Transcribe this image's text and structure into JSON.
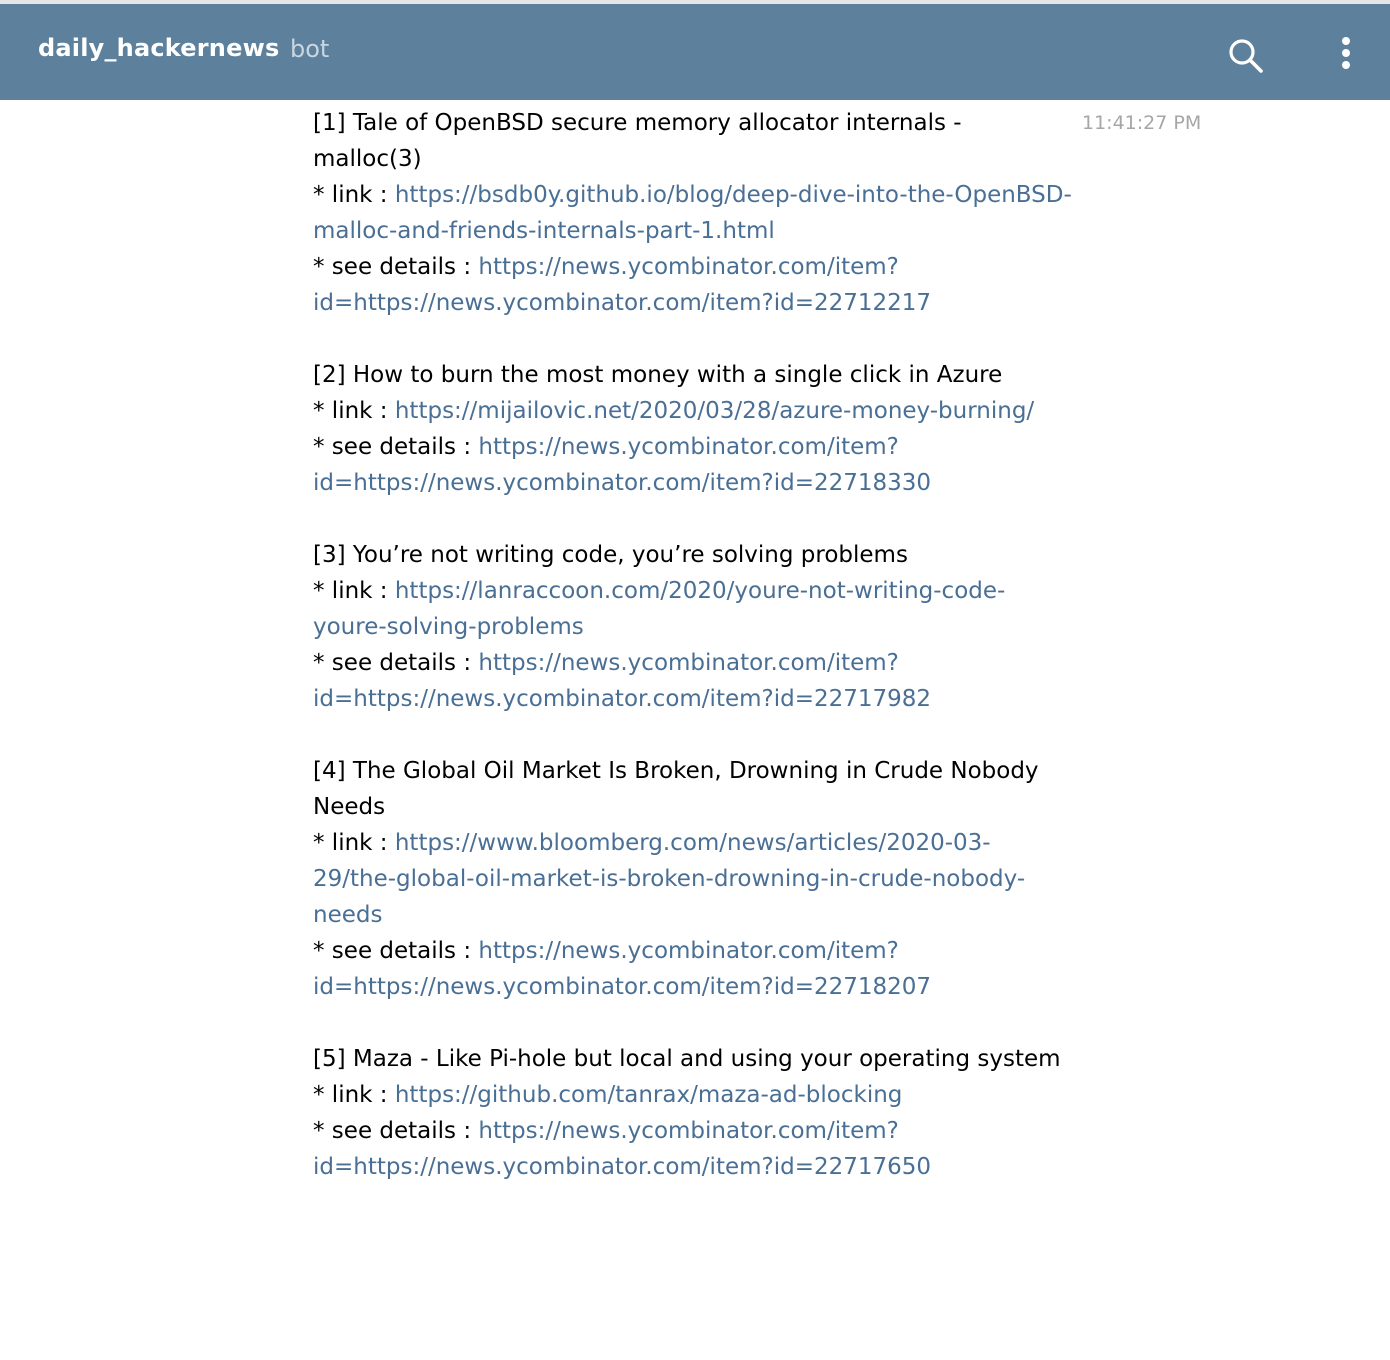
{
  "header": {
    "title": "daily_hackernews",
    "subtitle": "bot"
  },
  "message": {
    "timestamp": "11:41:27 PM",
    "link_label": "* link : ",
    "details_label": "* see details : ",
    "items": [
      {
        "title": "[1] Tale of OpenBSD secure memory allocator internals - malloc(3)",
        "link": "https://bsdb0y.github.io/blog/deep-dive-into-the-OpenBSD-malloc-and-friends-internals-part-1.html",
        "details": "https://news.ycombinator.com/item?id=https://news.ycombinator.com/item?id=22712217"
      },
      {
        "title": "[2] How to burn the most money with a single click in Azure",
        "link": "https://mijailovic.net/2020/03/28/azure-money-burning/",
        "details": "https://news.ycombinator.com/item?id=https://news.ycombinator.com/item?id=22718330"
      },
      {
        "title": "[3] You’re not writing code, you’re solving problems",
        "link": "https://lanraccoon.com/2020/youre-not-writing-code-youre-solving-problems",
        "details": "https://news.ycombinator.com/item?id=https://news.ycombinator.com/item?id=22717982"
      },
      {
        "title": "[4] The Global Oil Market Is Broken, Drowning in Crude Nobody Needs",
        "link": "https://www.bloomberg.com/news/articles/2020-03-29/the-global-oil-market-is-broken-drowning-in-crude-nobody-needs",
        "details": "https://news.ycombinator.com/item?id=https://news.ycombinator.com/item?id=22718207"
      },
      {
        "title": "[5] Maza - Like Pi-hole but local and using your operating system",
        "link": "https://github.com/tanrax/maza-ad-blocking",
        "details": "https://news.ycombinator.com/item?id=https://news.ycombinator.com/item?id=22717650"
      }
    ]
  },
  "icons": {
    "search": "search-icon",
    "menu": "more-vertical-icon"
  },
  "colors": {
    "header_bg": "#5d809d",
    "link": "#4a6f95",
    "timestamp": "#a6a6a6"
  }
}
